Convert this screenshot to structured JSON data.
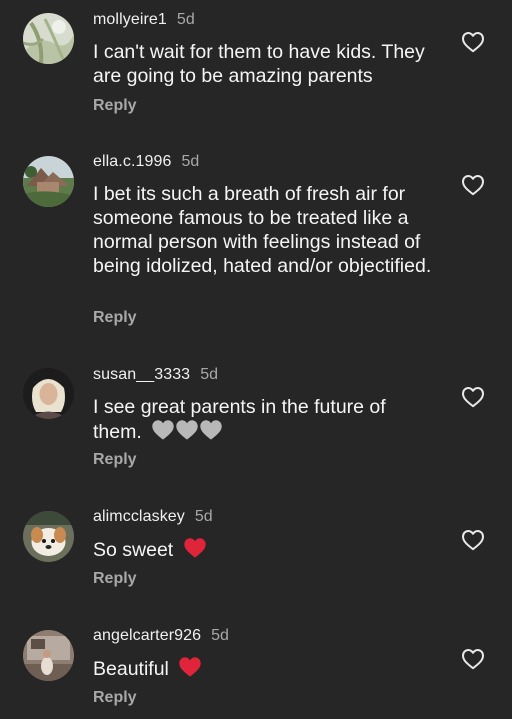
{
  "comments": [
    {
      "username": "mollyeire1",
      "time": "5d",
      "text": "I can't wait for them to have kids. They are going to be amazing parents",
      "reply": "Reply"
    },
    {
      "username": "ella.c.1996",
      "time": "5d",
      "text": "I bet its such a breath of fresh air for someone famous to be treated like a normal person with feelings instead of being idolized, hated and/or objectified.",
      "reply": "Reply"
    },
    {
      "username": "susan__3333",
      "time": "5d",
      "text": "I see great parents in the future of them.",
      "emoji": "grey-heart x3",
      "reply": "Reply"
    },
    {
      "username": "alimcclaskey",
      "time": "5d",
      "text": "So sweet",
      "emoji": "red-heart",
      "reply": "Reply"
    },
    {
      "username": "angelcarter926",
      "time": "5d",
      "text": "Beautiful",
      "emoji": "red-heart",
      "reply": "Reply"
    }
  ],
  "icons": {
    "like": "heart-outline-icon",
    "grey_heart": "grey-heart-emoji",
    "red_heart": "red-heart-emoji"
  },
  "colors": {
    "background": "#262626",
    "text": "#f5f5f5",
    "secondary": "#a8a8a8",
    "red_heart": "#e0243a",
    "grey_heart": "#b8b8b8"
  }
}
